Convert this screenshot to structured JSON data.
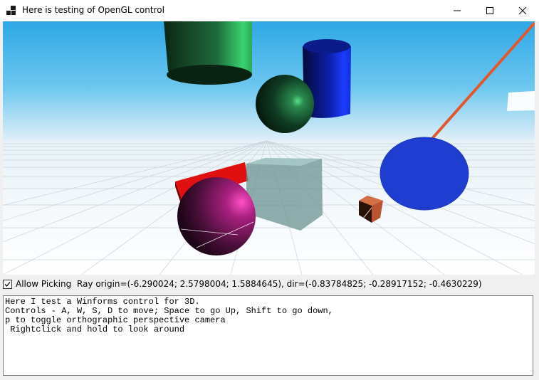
{
  "window": {
    "title": "Here is testing of OpenGL control",
    "icon": "app-window-icon",
    "buttons": {
      "minimize": "minimize-icon",
      "maximize": "maximize-icon",
      "close": "close-icon"
    }
  },
  "viewport": {
    "sky_top_color": "#2ea8e5",
    "sky_bottom_color": "#d6ecf8",
    "floor_color": "#ffffff",
    "grid_color": "#cfd6db",
    "ray_color": "#e4572e"
  },
  "controls": {
    "allow_picking_label": "Allow Picking",
    "allow_picking_checked": true,
    "ray_text": "Ray origin=(-6.290024; 2.5798004; 1.5884645), dir=(-0.83784825; -0.28917152; -0.4630229)"
  },
  "log": {
    "text": "Here I test a Winforms control for 3D.\nControls - A, W, S, D to move; Space to go Up, Shift to go down,\np to toggle orthographic perspective camera\n Rightclick and hold to look around"
  }
}
